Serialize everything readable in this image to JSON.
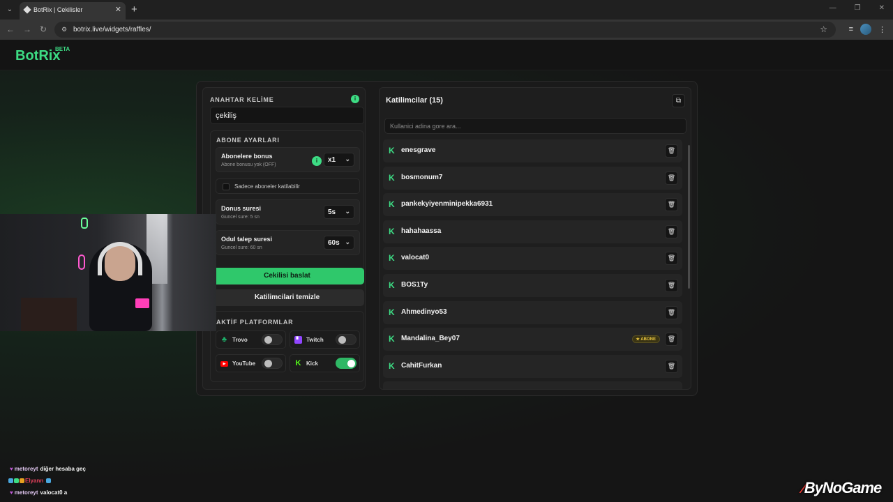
{
  "browser": {
    "tab_title": "BotRix | Cekilisler",
    "url": "botrix.live/widgets/raffles/"
  },
  "header": {
    "logo": "BotRix",
    "beta": "BETA"
  },
  "keyword": {
    "title": "ANAHTAR KELİME",
    "value": "çekiliş"
  },
  "abone": {
    "title": "ABONE AYARLARI",
    "bonus": {
      "label": "Abonelere bonus",
      "sub": "Abone bonusu yok (OFF)",
      "value": "x1"
    },
    "only_subs": "Sadece aboneler katilabilir",
    "donus": {
      "label": "Donus suresi",
      "sub": "Guncel sure: 5 sn",
      "value": "5s"
    },
    "odul": {
      "label": "Odul talep suresi",
      "sub": "Guncel sure: 60 sn",
      "value": "60s"
    }
  },
  "buttons": {
    "start": "Cekilisi baslat",
    "clear": "Katilimcilari temizle"
  },
  "platforms": {
    "title": "AKTİF PLATFORMLAR",
    "items": [
      {
        "name": "Trovo",
        "on": false,
        "color": "#1cb36b"
      },
      {
        "name": "Twitch",
        "on": false,
        "color": "#9146ff"
      },
      {
        "name": "YouTube",
        "on": false,
        "color": "#ff0000"
      },
      {
        "name": "Kick",
        "on": true,
        "color": "#53fc18"
      }
    ]
  },
  "participants": {
    "title": "Katilimcilar (15)",
    "search_placeholder": "Kullanici adina gore ara...",
    "badge": "ABONE",
    "items": [
      {
        "name": "enesgrave",
        "sub": false
      },
      {
        "name": "bosmonum7",
        "sub": false
      },
      {
        "name": "pankekyiyenminipekka6931",
        "sub": false
      },
      {
        "name": "hahahaassa",
        "sub": false
      },
      {
        "name": "valocat0",
        "sub": false
      },
      {
        "name": "BOS1Ty",
        "sub": false
      },
      {
        "name": "Ahmedinyo53",
        "sub": false
      },
      {
        "name": "Mandalina_Bey07",
        "sub": true
      },
      {
        "name": "CahitFurkan",
        "sub": false
      }
    ]
  },
  "chat": [
    {
      "user": "metoreyt",
      "msg": "diğer hesaba geç"
    },
    {
      "user": "Elyann",
      "msg": ""
    },
    {
      "user": "metoreyt",
      "msg": "valocat0 a"
    }
  ],
  "watermark": "ByNoGame",
  "accent": "#3ddc84"
}
